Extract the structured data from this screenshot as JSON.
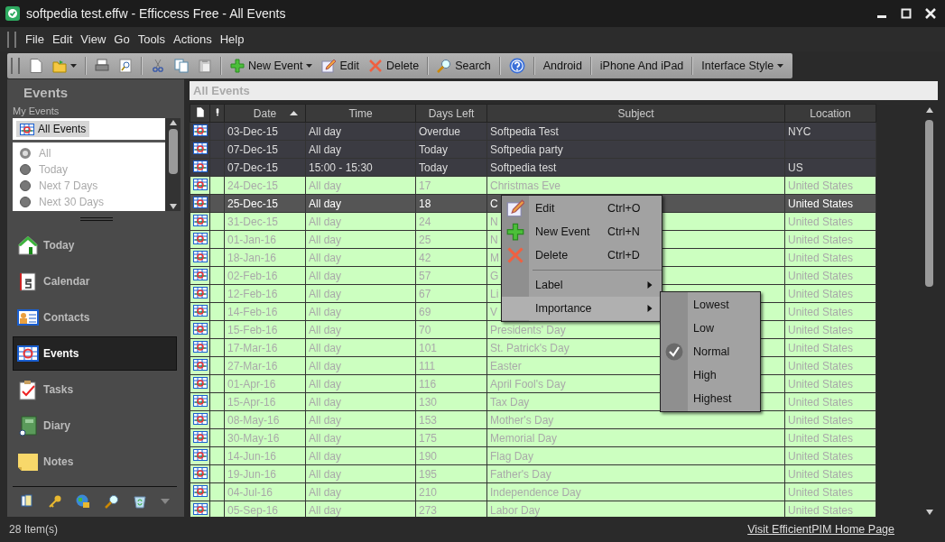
{
  "window": {
    "title": "softpedia test.effw - Efficcess Free - All Events"
  },
  "menu_bar": [
    "File",
    "Edit",
    "View",
    "Go",
    "Tools",
    "Actions",
    "Help"
  ],
  "toolbar": [
    {
      "label": "New Event",
      "dropdown": true
    },
    {
      "label": "Edit",
      "dropdown": false
    },
    {
      "label": "Delete",
      "dropdown": false
    },
    {
      "label": "Search",
      "dropdown": false
    },
    {
      "label": "Android",
      "dropdown": false
    },
    {
      "label": "iPhone And iPad",
      "dropdown": false
    },
    {
      "label": "Interface Style",
      "dropdown": true
    }
  ],
  "sidebar": {
    "title": "Events",
    "group_label": "My Events",
    "groups": [
      {
        "label": "All Events",
        "selected": true
      }
    ],
    "filters": [
      {
        "label": "All",
        "selected": true
      },
      {
        "label": "Today",
        "selected": false
      },
      {
        "label": "Next 7 Days",
        "selected": false
      },
      {
        "label": "Next 30 Days",
        "selected": false
      }
    ],
    "nav": [
      {
        "label": "Today",
        "selected": false
      },
      {
        "label": "Calendar",
        "selected": false
      },
      {
        "label": "Contacts",
        "selected": false
      },
      {
        "label": "Events",
        "selected": true
      },
      {
        "label": "Tasks",
        "selected": false
      },
      {
        "label": "Diary",
        "selected": false
      },
      {
        "label": "Notes",
        "selected": false
      }
    ]
  },
  "view_title": "All Events",
  "table": {
    "columns": [
      {
        "label": "Date",
        "sorted": true
      },
      {
        "label": "Time",
        "sorted": false
      },
      {
        "label": "Days Left",
        "sorted": false
      },
      {
        "label": "Subject",
        "sorted": false
      },
      {
        "label": "Location",
        "sorted": false
      }
    ],
    "rows": [
      {
        "kind": "event",
        "selected": false,
        "cells": [
          "03-Dec-15",
          "All day",
          "Overdue",
          "Softpedia Test",
          "NYC"
        ]
      },
      {
        "kind": "event",
        "selected": false,
        "cells": [
          "07-Dec-15",
          "All day",
          "Today",
          "Softpedia party",
          ""
        ]
      },
      {
        "kind": "event",
        "selected": false,
        "cells": [
          "07-Dec-15",
          "15:00 - 15:30",
          "Today",
          "Softpedia test",
          "US"
        ]
      },
      {
        "kind": "holiday",
        "selected": false,
        "cells": [
          "24-Dec-15",
          "All day",
          "17",
          "Christmas Eve",
          "United States"
        ]
      },
      {
        "kind": "holiday",
        "selected": true,
        "cells": [
          "25-Dec-15",
          "All day",
          "18",
          "C",
          "United States"
        ]
      },
      {
        "kind": "holiday",
        "selected": false,
        "cells": [
          "31-Dec-15",
          "All day",
          "24",
          "N",
          "United States"
        ]
      },
      {
        "kind": "holiday",
        "selected": false,
        "cells": [
          "01-Jan-16",
          "All day",
          "25",
          "N",
          "United States"
        ]
      },
      {
        "kind": "holiday",
        "selected": false,
        "cells": [
          "18-Jan-16",
          "All day",
          "42",
          "M",
          "United States"
        ]
      },
      {
        "kind": "holiday",
        "selected": false,
        "cells": [
          "02-Feb-16",
          "All day",
          "57",
          "G",
          "United States"
        ]
      },
      {
        "kind": "holiday",
        "selected": false,
        "cells": [
          "12-Feb-16",
          "All day",
          "67",
          "Li",
          "United States"
        ]
      },
      {
        "kind": "holiday",
        "selected": false,
        "cells": [
          "14-Feb-16",
          "All day",
          "69",
          "V",
          "United States"
        ]
      },
      {
        "kind": "holiday",
        "selected": false,
        "cells": [
          "15-Feb-16",
          "All day",
          "70",
          "Presidents' Day",
          "United States"
        ]
      },
      {
        "kind": "holiday",
        "selected": false,
        "cells": [
          "17-Mar-16",
          "All day",
          "101",
          "St. Patrick's Day",
          "United States"
        ]
      },
      {
        "kind": "holiday",
        "selected": false,
        "cells": [
          "27-Mar-16",
          "All day",
          "111",
          "Easter",
          "United States"
        ]
      },
      {
        "kind": "holiday",
        "selected": false,
        "cells": [
          "01-Apr-16",
          "All day",
          "116",
          "April Fool's Day",
          "United States"
        ]
      },
      {
        "kind": "holiday",
        "selected": false,
        "cells": [
          "15-Apr-16",
          "All day",
          "130",
          "Tax Day",
          "United States"
        ]
      },
      {
        "kind": "holiday",
        "selected": false,
        "cells": [
          "08-May-16",
          "All day",
          "153",
          "Mother's Day",
          "United States"
        ]
      },
      {
        "kind": "holiday",
        "selected": false,
        "cells": [
          "30-May-16",
          "All day",
          "175",
          "Memorial Day",
          "United States"
        ]
      },
      {
        "kind": "holiday",
        "selected": false,
        "cells": [
          "14-Jun-16",
          "All day",
          "190",
          "Flag Day",
          "United States"
        ]
      },
      {
        "kind": "holiday",
        "selected": false,
        "cells": [
          "19-Jun-16",
          "All day",
          "195",
          "Father's Day",
          "United States"
        ]
      },
      {
        "kind": "holiday",
        "selected": false,
        "cells": [
          "04-Jul-16",
          "All day",
          "210",
          "Independence Day",
          "United States"
        ]
      },
      {
        "kind": "holiday",
        "selected": false,
        "cells": [
          "05-Sep-16",
          "All day",
          "273",
          "Labor Day",
          "United States"
        ]
      }
    ]
  },
  "context_menu": {
    "items": [
      {
        "kind": "item",
        "label": "Edit",
        "shortcut": "Ctrl+O",
        "highlighted": false
      },
      {
        "kind": "item",
        "label": "New Event",
        "shortcut": "Ctrl+N",
        "highlighted": false
      },
      {
        "kind": "item",
        "label": "Delete",
        "shortcut": "Ctrl+D",
        "highlighted": false
      },
      {
        "kind": "separator"
      },
      {
        "kind": "submenu",
        "label": "Label",
        "highlighted": false
      },
      {
        "kind": "submenu",
        "label": "Importance",
        "highlighted": true
      }
    ],
    "submenu": {
      "items": [
        {
          "label": "Lowest",
          "checked": false
        },
        {
          "label": "Low",
          "checked": false
        },
        {
          "label": "Normal",
          "checked": true
        },
        {
          "label": "High",
          "checked": false
        },
        {
          "label": "Highest",
          "checked": false
        }
      ]
    }
  },
  "status_bar": {
    "count": "28 Item(s)",
    "link": "Visit EfficientPIM Home Page"
  }
}
